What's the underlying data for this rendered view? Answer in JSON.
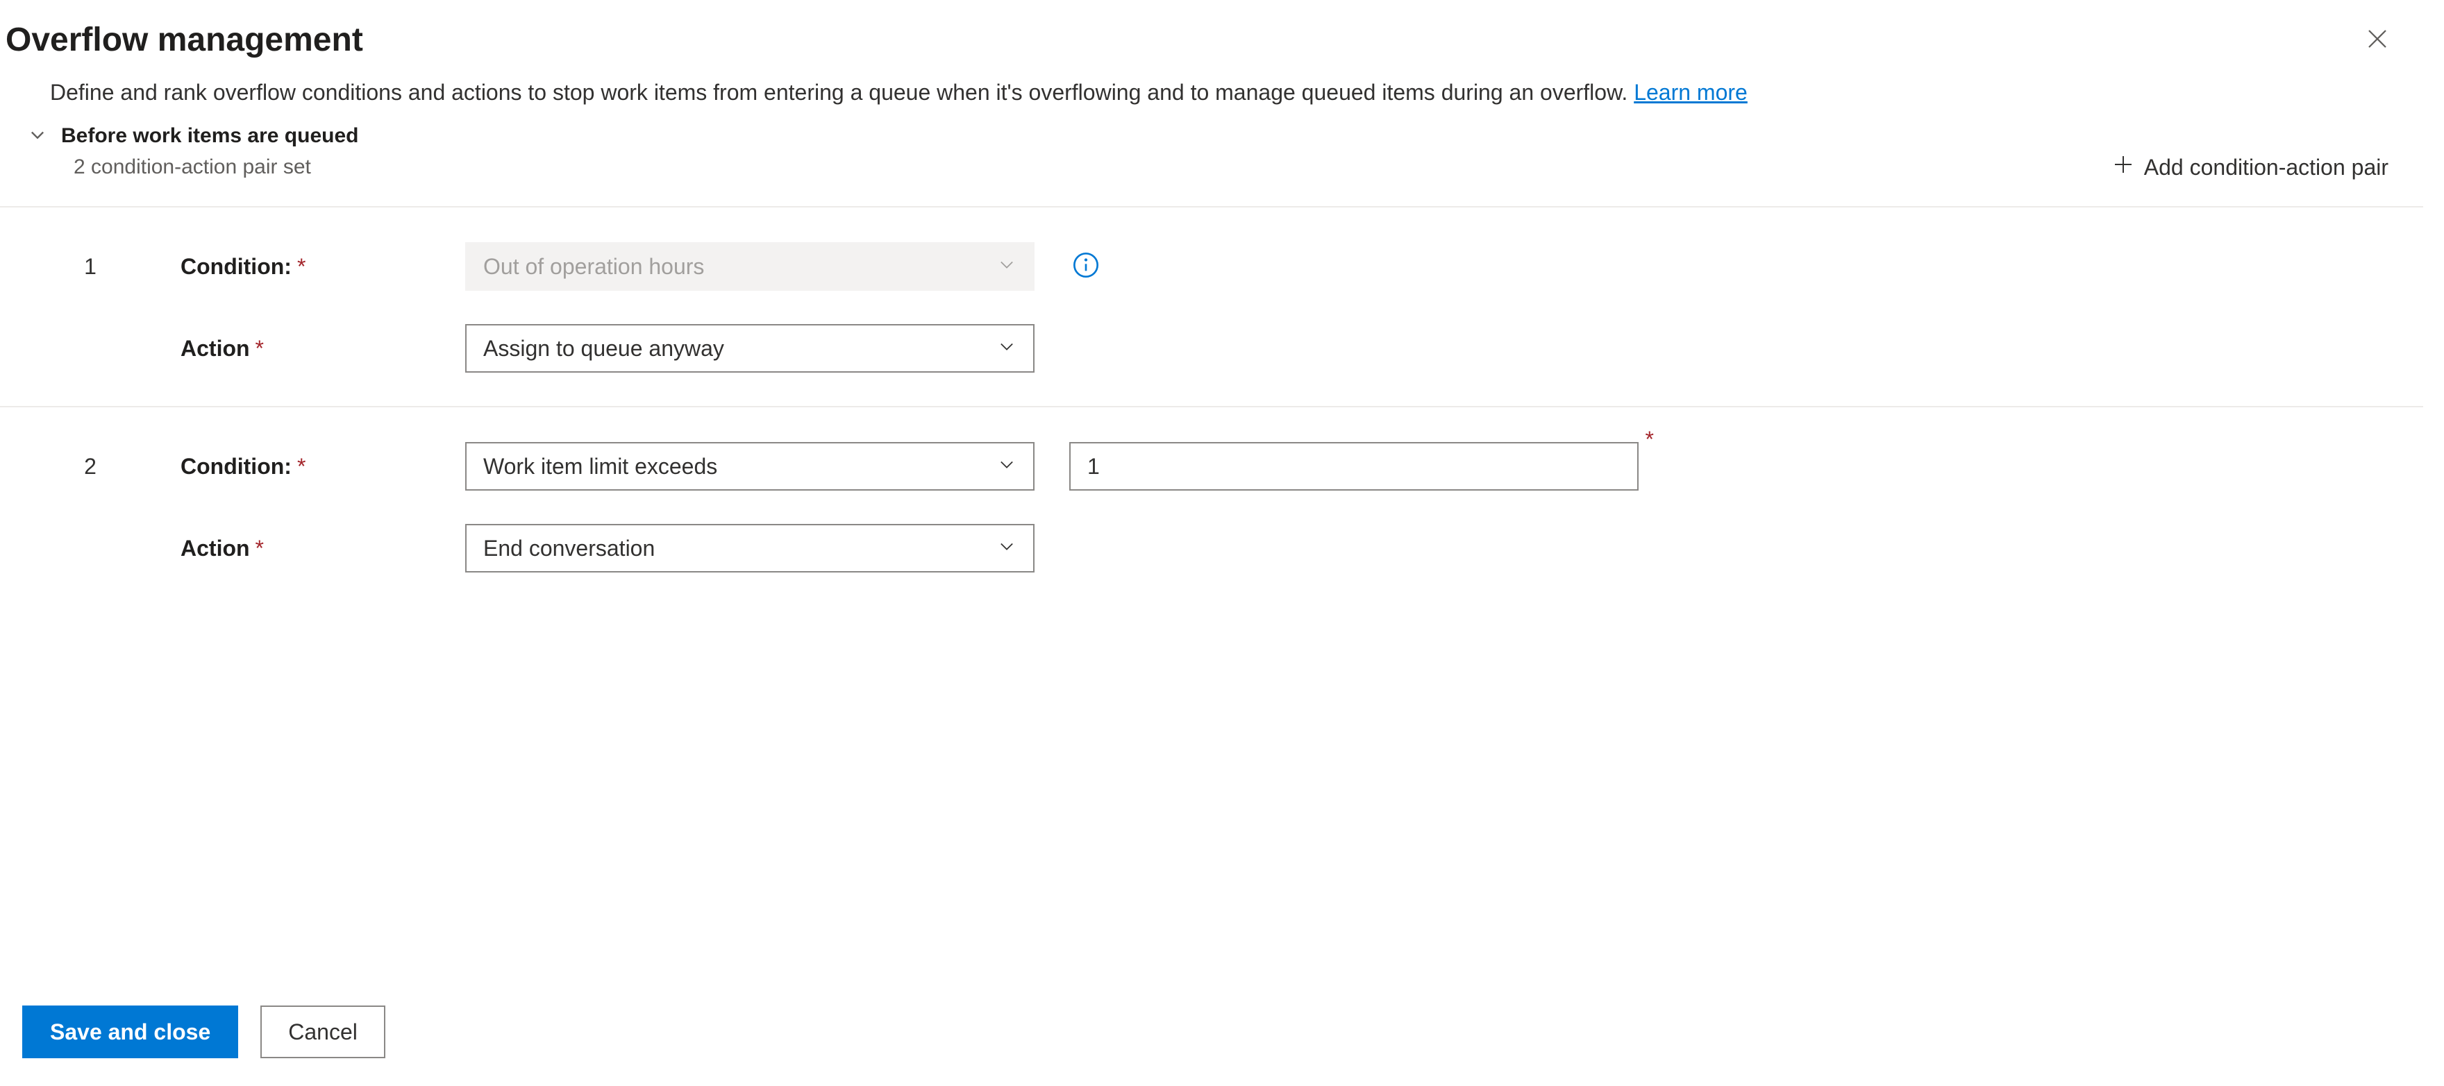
{
  "header": {
    "title": "Overflow management",
    "description": "Define and rank overflow conditions and actions to stop work items from entering a queue when it's overflowing and to manage queued items during an overflow. ",
    "learn_more": "Learn more"
  },
  "section": {
    "title": "Before work items are queued",
    "subtitle": "2 condition-action pair set",
    "add_button_label": "Add condition-action pair"
  },
  "labels": {
    "condition": "Condition:",
    "action": "Action"
  },
  "pairs": [
    {
      "index": "1",
      "condition_value": "Out of operation hours",
      "condition_disabled": true,
      "show_info": true,
      "action_value": "Assign to queue anyway",
      "extra_input": null
    },
    {
      "index": "2",
      "condition_value": "Work item limit exceeds",
      "condition_disabled": false,
      "show_info": false,
      "action_value": "End conversation",
      "extra_input": "1"
    }
  ],
  "footer": {
    "save_label": "Save and close",
    "cancel_label": "Cancel"
  }
}
